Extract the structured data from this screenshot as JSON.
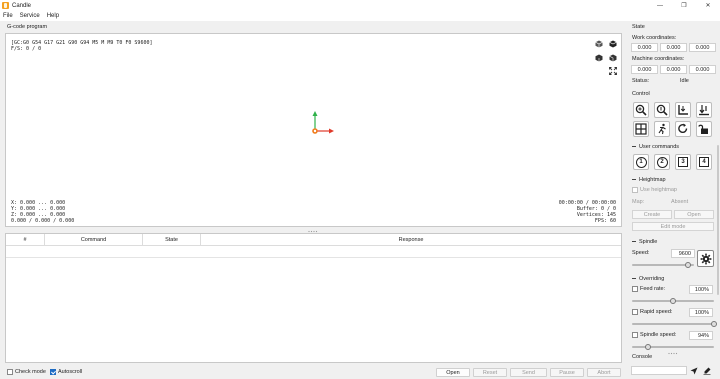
{
  "window": {
    "title": "Candle",
    "minimize": "—",
    "maximize": "❐",
    "close": "✕"
  },
  "menu": {
    "items": [
      "File",
      "Service",
      "Help"
    ]
  },
  "gcode_program": {
    "label": "G-code program",
    "status_line": "[GC:G0 G54 G17 G21 G90 G94 M5 M M9 T0 F0 S9600]",
    "fps_line": "F/S: 0 / 0",
    "coords_lines": [
      "X: 0.000 ... 0.000",
      "Y: 0.000 ... 0.000",
      "Z: 0.000 ... 0.000",
      "0.000 / 0.000 / 0.000"
    ],
    "stats_lines": [
      "00:00:00 / 00:00:00",
      "Buffer: 0 / 0",
      "Vertices: 145",
      "FPS: 60"
    ]
  },
  "table": {
    "columns": [
      "#",
      "Command",
      "State",
      "Response"
    ]
  },
  "bottom": {
    "check_mode_label": "Check mode",
    "autoscroll_label": "Autoscroll",
    "open_label": "Open",
    "reset_label": "Reset",
    "send_label": "Send",
    "pause_label": "Pause",
    "abort_label": "Abort"
  },
  "state": {
    "title": "State",
    "work_label": "Work coordinates:",
    "work": [
      "0.000",
      "0.000",
      "0.000"
    ],
    "machine_label": "Machine coordinates:",
    "machine": [
      "0.000",
      "0.000",
      "0.000"
    ],
    "status_label": "Status:",
    "status_value": "Idle"
  },
  "control": {
    "title": "Control"
  },
  "user_commands": {
    "title": "User commands",
    "buttons": [
      "1",
      "2",
      "3",
      "4"
    ]
  },
  "heightmap": {
    "title": "Heightmap",
    "use_label": "Use heightmap",
    "map_label": "Map:",
    "map_value": "Absent",
    "create_label": "Create",
    "open_label": "Open",
    "edit_label": "Edit mode"
  },
  "spindle": {
    "title": "Spindle",
    "speed_label": "Speed:",
    "speed_value": "9600",
    "speed_fraction": 0.9
  },
  "overriding": {
    "title": "Overriding",
    "feed_label": "Feed rate:",
    "feed_value": "100%",
    "feed_fraction": 0.5,
    "rapid_label": "Rapid speed:",
    "rapid_value": "100%",
    "rapid_fraction": 1.0,
    "spindle_label": "Spindle speed:",
    "spindle_value": "94%",
    "spindle_fraction": 0.2
  },
  "console": {
    "title": "Console",
    "input_placeholder": ""
  },
  "colors": {
    "accent": "#1e6cc4",
    "axis_x": "#e03a2a",
    "axis_y": "#2fb24a",
    "origin": "#f07c1c"
  }
}
